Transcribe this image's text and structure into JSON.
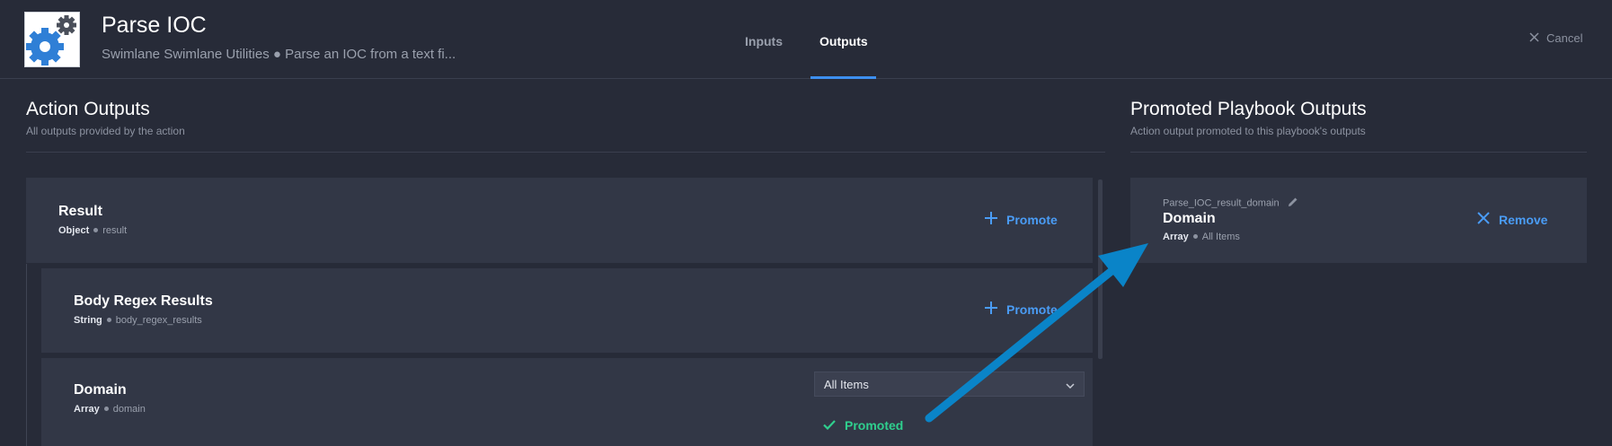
{
  "header": {
    "title": "Parse IOC",
    "subtitle": "Swimlane Swimlane Utilities ● Parse an IOC from a text fi...",
    "tabs": [
      {
        "label": "Inputs",
        "active": false
      },
      {
        "label": "Outputs",
        "active": true
      }
    ],
    "cancel_label": "Cancel",
    "icon": "gear-icon"
  },
  "action_outputs": {
    "title": "Action Outputs",
    "subtitle": "All outputs provided by the action",
    "items": [
      {
        "title": "Result",
        "type": "Object",
        "key": "result",
        "action": "Promote"
      },
      {
        "title": "Body Regex Results",
        "type": "String",
        "key": "body_regex_results",
        "action": "Promote"
      },
      {
        "title": "Domain",
        "type": "Array",
        "key": "domain",
        "select_value": "All Items",
        "status": "Promoted"
      }
    ]
  },
  "promoted_outputs": {
    "title": "Promoted Playbook Outputs",
    "subtitle": "Action output promoted to this playbook's outputs",
    "items": [
      {
        "name": "Parse_IOC_result_domain",
        "title": "Domain",
        "type": "Array",
        "scope": "All Items",
        "action": "Remove"
      }
    ]
  },
  "colors": {
    "accent": "#4a9cf5",
    "success": "#2fcf8e",
    "arrow": "#0a84c8",
    "background": "#272b38",
    "card": "#323746"
  }
}
